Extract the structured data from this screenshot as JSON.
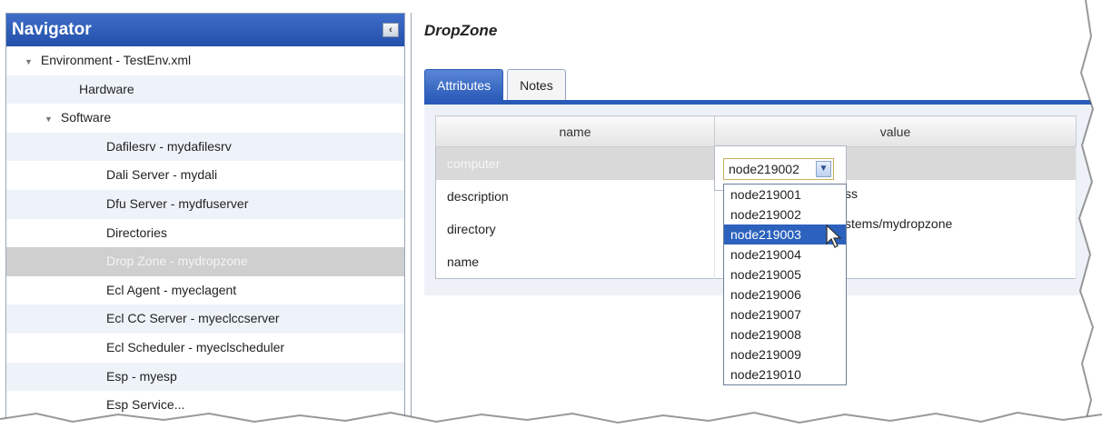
{
  "navigator": {
    "title": "Navigator",
    "collapse_glyph": "‹",
    "items": [
      {
        "label": "Environment - TestEnv.xml",
        "expanded": true
      },
      {
        "label": "Hardware"
      },
      {
        "label": "Software",
        "expanded": true
      },
      {
        "label": "Dafilesrv - mydafilesrv"
      },
      {
        "label": "Dali Server - mydali"
      },
      {
        "label": "Dfu Server - mydfuserver"
      },
      {
        "label": "Directories"
      },
      {
        "label": "Drop Zone - mydropzone",
        "selected": true
      },
      {
        "label": "Ecl Agent - myeclagent"
      },
      {
        "label": "Ecl CC Server - myeclccserver"
      },
      {
        "label": "Ecl Scheduler - myeclscheduler"
      },
      {
        "label": "Esp - myesp"
      },
      {
        "label": "Esp Service..."
      }
    ]
  },
  "main": {
    "title": "DropZone",
    "tabs": [
      "Attributes",
      "Notes"
    ],
    "active_tab": "Attributes",
    "grid": {
      "columns": [
        "name",
        "value"
      ],
      "rows": [
        {
          "name": "computer",
          "value": "",
          "selected": true
        },
        {
          "name": "description",
          "value": "ss"
        },
        {
          "name": "directory",
          "value": "stems/mydropzone"
        },
        {
          "name": "name",
          "value": ""
        }
      ]
    },
    "dropdown": {
      "selected": "node219002",
      "highlighted": "node219003",
      "options": [
        "node219001",
        "node219002",
        "node219003",
        "node219004",
        "node219005",
        "node219006",
        "node219007",
        "node219008",
        "node219009",
        "node219010"
      ]
    }
  },
  "colors": {
    "header_blue": "#2250aa",
    "tab_active": "#2a5bb8",
    "highlight": "#2c62bd",
    "selected_row": "#cfcfcf"
  },
  "icons": {
    "expand": "triangle-down-icon",
    "collapse_panel": "chevron-left-icon",
    "dropdown": "chevron-down-icon",
    "cursor": "arrow-cursor-icon"
  }
}
